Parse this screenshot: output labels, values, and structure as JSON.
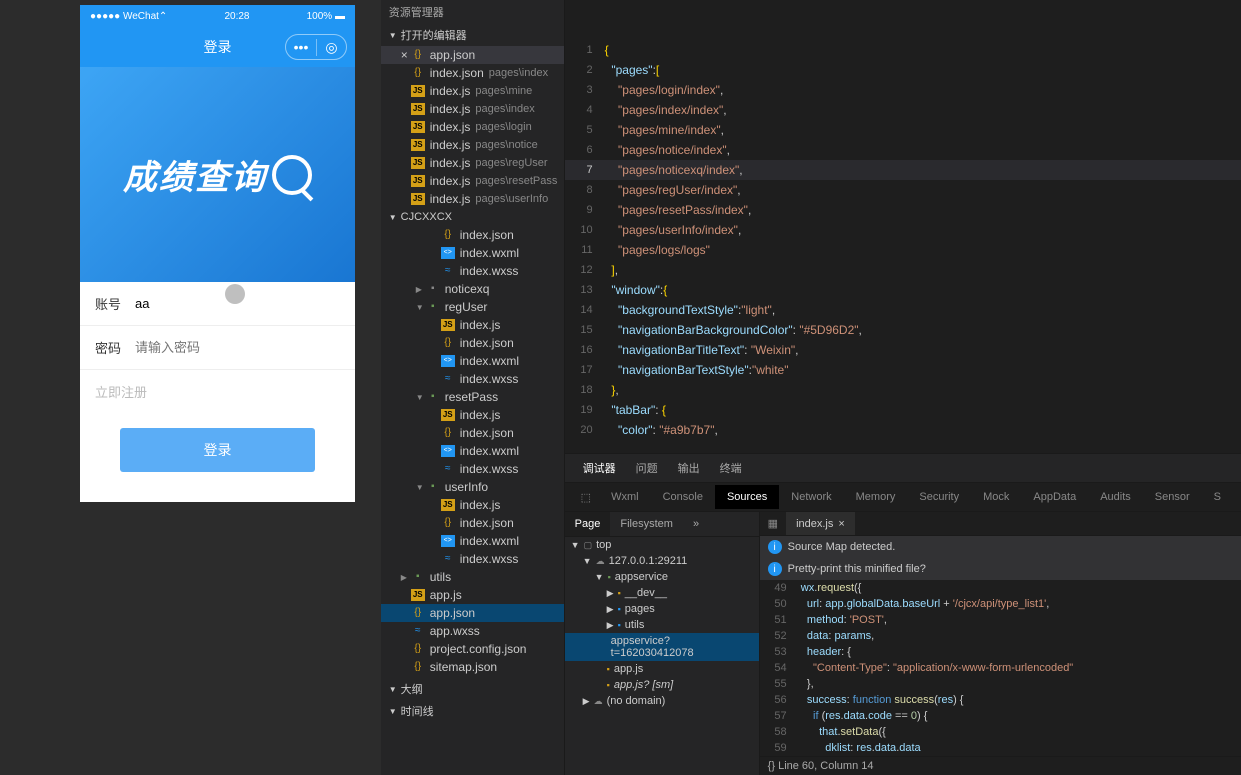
{
  "phone": {
    "carrier": "●●●●● WeChat⌃",
    "time": "20:28",
    "battery": "100% ▬",
    "title": "登录",
    "banner": "成绩查询",
    "field1_label": "账号",
    "field1_value": "aa",
    "field2_label": "密码",
    "field2_placeholder": "请输入密码",
    "register": "立即注册",
    "login_btn": "登录"
  },
  "explorer": {
    "top_header": "资源管理器",
    "openEditors": "打开的编辑器",
    "open": [
      {
        "icon": "{}",
        "name": "app.json",
        "close": "×",
        "active": true
      },
      {
        "icon": "{}",
        "name": "index.json",
        "path": "pages\\index"
      },
      {
        "icon": "JS",
        "name": "index.js",
        "path": "pages\\mine"
      },
      {
        "icon": "JS",
        "name": "index.js",
        "path": "pages\\index"
      },
      {
        "icon": "JS",
        "name": "index.js",
        "path": "pages\\login"
      },
      {
        "icon": "JS",
        "name": "index.js",
        "path": "pages\\notice"
      },
      {
        "icon": "JS",
        "name": "index.js",
        "path": "pages\\regUser"
      },
      {
        "icon": "JS",
        "name": "index.js",
        "path": "pages\\resetPass"
      },
      {
        "icon": "JS",
        "name": "index.js",
        "path": "pages\\userInfo"
      }
    ],
    "project": "CJCXXCX",
    "tree": [
      {
        "ind": 1,
        "icon": "{}",
        "cls": "ico-json",
        "name": "index.json"
      },
      {
        "ind": 1,
        "icon": "<>",
        "cls": "ico-wxml",
        "name": "index.wxml"
      },
      {
        "ind": 1,
        "icon": "≈",
        "cls": "ico-wxss",
        "name": "index.wxss"
      },
      {
        "ind": 0,
        "arrow": "▶",
        "icon": "▪",
        "cls": "ico-folder",
        "name": "noticexq"
      },
      {
        "ind": 0,
        "arrow": "▼",
        "icon": "▪",
        "cls": "ico-folder-open",
        "name": "regUser"
      },
      {
        "ind": 1,
        "icon": "JS",
        "cls": "ico-js",
        "name": "index.js"
      },
      {
        "ind": 1,
        "icon": "{}",
        "cls": "ico-json",
        "name": "index.json"
      },
      {
        "ind": 1,
        "icon": "<>",
        "cls": "ico-wxml",
        "name": "index.wxml"
      },
      {
        "ind": 1,
        "icon": "≈",
        "cls": "ico-wxss",
        "name": "index.wxss"
      },
      {
        "ind": 0,
        "arrow": "▼",
        "icon": "▪",
        "cls": "ico-folder-open",
        "name": "resetPass"
      },
      {
        "ind": 1,
        "icon": "JS",
        "cls": "ico-js",
        "name": "index.js"
      },
      {
        "ind": 1,
        "icon": "{}",
        "cls": "ico-json",
        "name": "index.json"
      },
      {
        "ind": 1,
        "icon": "<>",
        "cls": "ico-wxml",
        "name": "index.wxml"
      },
      {
        "ind": 1,
        "icon": "≈",
        "cls": "ico-wxss",
        "name": "index.wxss"
      },
      {
        "ind": 0,
        "arrow": "▼",
        "icon": "▪",
        "cls": "ico-folder-open",
        "name": "userInfo"
      },
      {
        "ind": 1,
        "icon": "JS",
        "cls": "ico-js",
        "name": "index.js"
      },
      {
        "ind": 1,
        "icon": "{}",
        "cls": "ico-json",
        "name": "index.json"
      },
      {
        "ind": 1,
        "icon": "<>",
        "cls": "ico-wxml",
        "name": "index.wxml"
      },
      {
        "ind": 1,
        "icon": "≈",
        "cls": "ico-wxss",
        "name": "index.wxss"
      },
      {
        "ind": -1,
        "arrow": "▶",
        "icon": "▪",
        "cls": "ico-folder-open",
        "name": "utils"
      },
      {
        "ind": -1,
        "icon": "JS",
        "cls": "ico-js",
        "name": "app.js"
      },
      {
        "ind": -1,
        "icon": "{}",
        "cls": "ico-json",
        "name": "app.json",
        "selected": true
      },
      {
        "ind": -1,
        "icon": "≈",
        "cls": "ico-wxss",
        "name": "app.wxss"
      },
      {
        "ind": -1,
        "icon": "{}",
        "cls": "ico-json",
        "name": "project.config.json"
      },
      {
        "ind": -1,
        "icon": "{}",
        "cls": "ico-json",
        "name": "sitemap.json"
      }
    ],
    "outline": "大纲",
    "timeline": "时间线"
  },
  "code": {
    "lines": [
      {
        "n": 1,
        "tokens": [
          [
            "brace",
            "{"
          ]
        ]
      },
      {
        "n": 2,
        "tokens": [
          [
            "punc",
            "  "
          ],
          [
            "key",
            "\"pages\""
          ],
          [
            "punc",
            ":"
          ],
          [
            "brace",
            "["
          ]
        ]
      },
      {
        "n": 3,
        "tokens": [
          [
            "punc",
            "    "
          ],
          [
            "str",
            "\"pages/login/index\""
          ],
          [
            "punc",
            ","
          ]
        ]
      },
      {
        "n": 4,
        "tokens": [
          [
            "punc",
            "    "
          ],
          [
            "str",
            "\"pages/index/index\""
          ],
          [
            "punc",
            ","
          ]
        ]
      },
      {
        "n": 5,
        "tokens": [
          [
            "punc",
            "    "
          ],
          [
            "str",
            "\"pages/mine/index\""
          ],
          [
            "punc",
            ","
          ]
        ]
      },
      {
        "n": 6,
        "tokens": [
          [
            "punc",
            "    "
          ],
          [
            "str",
            "\"pages/notice/index\""
          ],
          [
            "punc",
            ","
          ]
        ]
      },
      {
        "n": 7,
        "hl": true,
        "tokens": [
          [
            "punc",
            "    "
          ],
          [
            "str",
            "\"pages/noticexq/index\""
          ],
          [
            "punc",
            ","
          ]
        ]
      },
      {
        "n": 8,
        "tokens": [
          [
            "punc",
            "    "
          ],
          [
            "str",
            "\"pages/regUser/index\""
          ],
          [
            "punc",
            ","
          ]
        ]
      },
      {
        "n": 9,
        "tokens": [
          [
            "punc",
            "    "
          ],
          [
            "str",
            "\"pages/resetPass/index\""
          ],
          [
            "punc",
            ","
          ]
        ]
      },
      {
        "n": 10,
        "tokens": [
          [
            "punc",
            "    "
          ],
          [
            "str",
            "\"pages/userInfo/index\""
          ],
          [
            "punc",
            ","
          ]
        ]
      },
      {
        "n": 11,
        "tokens": [
          [
            "punc",
            "    "
          ],
          [
            "str",
            "\"pages/logs/logs\""
          ]
        ]
      },
      {
        "n": 12,
        "tokens": [
          [
            "punc",
            "  "
          ],
          [
            "brace",
            "]"
          ],
          [
            "punc",
            ","
          ]
        ]
      },
      {
        "n": 13,
        "tokens": [
          [
            "punc",
            "  "
          ],
          [
            "key",
            "\"window\""
          ],
          [
            "punc",
            ":"
          ],
          [
            "brace",
            "{"
          ]
        ]
      },
      {
        "n": 14,
        "tokens": [
          [
            "punc",
            "    "
          ],
          [
            "key",
            "\"backgroundTextStyle\""
          ],
          [
            "punc",
            ":"
          ],
          [
            "str",
            "\"light\""
          ],
          [
            "punc",
            ","
          ]
        ]
      },
      {
        "n": 15,
        "tokens": [
          [
            "punc",
            "    "
          ],
          [
            "key",
            "\"navigationBarBackgroundColor\""
          ],
          [
            "punc",
            ": "
          ],
          [
            "str",
            "\"#5D96D2\""
          ],
          [
            "punc",
            ","
          ]
        ]
      },
      {
        "n": 16,
        "tokens": [
          [
            "punc",
            "    "
          ],
          [
            "key",
            "\"navigationBarTitleText\""
          ],
          [
            "punc",
            ": "
          ],
          [
            "str",
            "\"Weixin\""
          ],
          [
            "punc",
            ","
          ]
        ]
      },
      {
        "n": 17,
        "tokens": [
          [
            "punc",
            "    "
          ],
          [
            "key",
            "\"navigationBarTextStyle\""
          ],
          [
            "punc",
            ":"
          ],
          [
            "str",
            "\"white\""
          ]
        ]
      },
      {
        "n": 18,
        "tokens": [
          [
            "punc",
            "  "
          ],
          [
            "brace",
            "}"
          ],
          [
            "punc",
            ","
          ]
        ]
      },
      {
        "n": 19,
        "tokens": [
          [
            "punc",
            "  "
          ],
          [
            "key",
            "\"tabBar\""
          ],
          [
            "punc",
            ": "
          ],
          [
            "brace",
            "{"
          ]
        ]
      },
      {
        "n": 20,
        "tokens": [
          [
            "punc",
            "    "
          ],
          [
            "key",
            "\"color\""
          ],
          [
            "punc",
            ": "
          ],
          [
            "str",
            "\"#a9b7b7\""
          ],
          [
            "punc",
            ","
          ]
        ]
      }
    ]
  },
  "debug": {
    "main_tabs": [
      "调试器",
      "问题",
      "输出",
      "终端"
    ],
    "subtabs": [
      "Wxml",
      "Console",
      "Sources",
      "Network",
      "Memory",
      "Security",
      "Mock",
      "AppData",
      "Audits",
      "Sensor",
      "S"
    ],
    "active_sub": "Sources",
    "pages_tabs": [
      "Page",
      "Filesystem",
      "»"
    ],
    "tree": [
      {
        "ind": 0,
        "arrow": "▼",
        "ico": "▢",
        "name": "top"
      },
      {
        "ind": 1,
        "arrow": "▼",
        "ico": "☁",
        "name": "127.0.0.1:29211"
      },
      {
        "ind": 2,
        "arrow": "▼",
        "ico": "▪",
        "name": "appservice",
        "color": "#6a9955"
      },
      {
        "ind": 3,
        "arrow": "▶",
        "ico": "▪",
        "name": "__dev__",
        "color": "#d4a017"
      },
      {
        "ind": 3,
        "arrow": "▶",
        "ico": "▪",
        "name": "pages",
        "color": "#2196f3"
      },
      {
        "ind": 3,
        "arrow": "▶",
        "ico": "▪",
        "name": "utils",
        "color": "#2196f3"
      },
      {
        "ind": 3,
        "ico": "",
        "name": "appservice?t=162030412078",
        "sel": true
      },
      {
        "ind": 3,
        "ico": "▪",
        "name": "app.js",
        "color": "#d4a017"
      },
      {
        "ind": 3,
        "ico": "▪",
        "name": "app.js? [sm]",
        "italic": true,
        "color": "#d4a017"
      },
      {
        "ind": 1,
        "arrow": "▶",
        "ico": "☁",
        "name": "(no domain)"
      }
    ],
    "src_tab": "index.js",
    "info1": "Source Map detected.",
    "info2": "Pretty-print this minified file?",
    "src_lines": [
      {
        "n": 49,
        "html": "  <span class='s-var'>wx</span>.<span class='s-fn'>request</span>({"
      },
      {
        "n": 50,
        "html": "    <span class='s-var'>url</span>: <span class='s-var'>app</span>.<span class='s-var'>globalData</span>.<span class='s-var'>baseUrl</span> + <span class='s-str'>'/cjcx/api/type_list1'</span>,"
      },
      {
        "n": 51,
        "html": "    <span class='s-var'>method</span>: <span class='s-str'>'POST'</span>,"
      },
      {
        "n": 52,
        "html": "    <span class='s-var'>data</span>: <span class='s-var'>params</span>,"
      },
      {
        "n": 53,
        "html": "    <span class='s-var'>header</span>: {"
      },
      {
        "n": 54,
        "html": "      <span class='s-str'>\"Content-Type\"</span>: <span class='s-str'>\"application/x-www-form-urlencoded\"</span>"
      },
      {
        "n": 55,
        "html": "    },"
      },
      {
        "n": 56,
        "html": "    <span class='s-var'>success</span>: <span class='s-kw'>function</span> <span class='s-fn'>success</span>(<span class='s-var'>res</span>) {"
      },
      {
        "n": 57,
        "html": "      <span class='s-kw'>if</span> (<span class='s-var'>res</span>.<span class='s-var'>data</span>.<span class='s-var'>code</span> == <span class='s-num'>0</span>) {"
      },
      {
        "n": 58,
        "html": "        <span class='s-var'>that</span>.<span class='s-fn'>setData</span>({"
      },
      {
        "n": 59,
        "html": "          <span class='s-var'>dklist</span>: <span class='s-var'>res</span>.<span class='s-var'>data</span>.<span class='s-var'>data</span>"
      }
    ],
    "status": "{}   Line 60, Column 14"
  }
}
